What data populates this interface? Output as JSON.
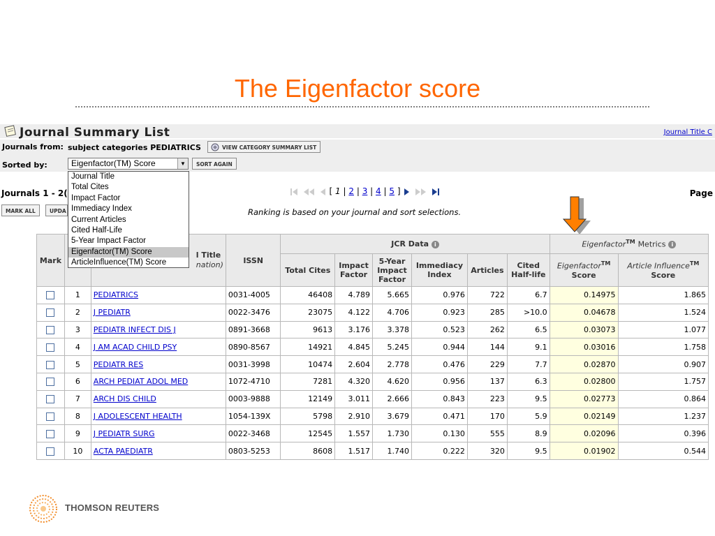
{
  "slide": {
    "title": "The Eigenfactor score"
  },
  "jcr": {
    "header_title": "Journal Summary List",
    "header_link": "Journal Title C",
    "journals_from_label": "Journals from:",
    "journals_from_value": "subject categories PEDIATRICS",
    "view_category_btn": "VIEW CATEGORY SUMMARY LIST",
    "sorted_by_label": "Sorted by:",
    "sort_selected": "Eigenfactor(TM) Score",
    "sort_again_btn": "SORT AGAIN",
    "sort_options": [
      "Journal Title",
      "Total Cites",
      "Impact Factor",
      "Immediacy Index",
      "Current Articles",
      "Cited Half-Life",
      "5-Year Impact Factor",
      "Eigenfactor(TM) Score",
      "ArticleInfluence(TM) Score"
    ],
    "range_text": "Journals 1 - 2(",
    "mark_all_btn": "MARK ALL",
    "update_btn": "UPDA",
    "pager": {
      "open": "[",
      "current": "1",
      "pages": [
        "2",
        "3",
        "4",
        "5"
      ],
      "sep": "|",
      "close": "]"
    },
    "page_label": "Page",
    "ranking_note": "Ranking is based on your journal and sort selections."
  },
  "table": {
    "headers": {
      "mark": "Mark",
      "title_partial": "l Title",
      "title_sub_partial": "nation)",
      "issn": "ISSN",
      "jcr_group": "JCR Data",
      "total_cites": "Total Cites",
      "impact_factor_1": "Impact",
      "impact_factor_2": "Factor",
      "five_year_1": "5-Year",
      "five_year_2": "Impact",
      "five_year_3": "Factor",
      "immediacy_1": "Immediacy",
      "immediacy_2": "Index",
      "articles": "Articles",
      "cited_hl_1": "Cited",
      "cited_hl_2": "Half-life",
      "eig_group": "Eigenfactor",
      "eig_group_tm": "TM",
      "eig_group_suffix": "Metrics",
      "eig_score_1": "Eigenfactor",
      "eig_score_tm": "TM",
      "eig_score_2": "Score",
      "ai_score_1": "Article Influence",
      "ai_score_tm": "TM",
      "ai_score_2": "Score"
    },
    "rows": [
      {
        "rank": "1",
        "title": "PEDIATRICS",
        "issn": "0031-4005",
        "total_cites": "46408",
        "impact_factor": "4.789",
        "five_year": "5.665",
        "immediacy": "0.976",
        "articles": "722",
        "cited_hl": "6.7",
        "eigenfactor": "0.14975",
        "ai": "1.865"
      },
      {
        "rank": "2",
        "title": "J PEDIATR",
        "issn": "0022-3476",
        "total_cites": "23075",
        "impact_factor": "4.122",
        "five_year": "4.706",
        "immediacy": "0.923",
        "articles": "285",
        "cited_hl": ">10.0",
        "eigenfactor": "0.04678",
        "ai": "1.524"
      },
      {
        "rank": "3",
        "title": "PEDIATR INFECT DIS J",
        "issn": "0891-3668",
        "total_cites": "9613",
        "impact_factor": "3.176",
        "five_year": "3.378",
        "immediacy": "0.523",
        "articles": "262",
        "cited_hl": "6.5",
        "eigenfactor": "0.03073",
        "ai": "1.077"
      },
      {
        "rank": "4",
        "title": "J AM ACAD CHILD PSY",
        "issn": "0890-8567",
        "total_cites": "14921",
        "impact_factor": "4.845",
        "five_year": "5.245",
        "immediacy": "0.944",
        "articles": "144",
        "cited_hl": "9.1",
        "eigenfactor": "0.03016",
        "ai": "1.758"
      },
      {
        "rank": "5",
        "title": "PEDIATR RES",
        "issn": "0031-3998",
        "total_cites": "10474",
        "impact_factor": "2.604",
        "five_year": "2.778",
        "immediacy": "0.476",
        "articles": "229",
        "cited_hl": "7.7",
        "eigenfactor": "0.02870",
        "ai": "0.907"
      },
      {
        "rank": "6",
        "title": "ARCH PEDIAT ADOL MED",
        "issn": "1072-4710",
        "total_cites": "7281",
        "impact_factor": "4.320",
        "five_year": "4.620",
        "immediacy": "0.956",
        "articles": "137",
        "cited_hl": "6.3",
        "eigenfactor": "0.02800",
        "ai": "1.757"
      },
      {
        "rank": "7",
        "title": "ARCH DIS CHILD",
        "issn": "0003-9888",
        "total_cites": "12149",
        "impact_factor": "3.011",
        "five_year": "2.666",
        "immediacy": "0.843",
        "articles": "223",
        "cited_hl": "9.5",
        "eigenfactor": "0.02773",
        "ai": "0.864"
      },
      {
        "rank": "8",
        "title": "J ADOLESCENT HEALTH",
        "issn": "1054-139X",
        "total_cites": "5798",
        "impact_factor": "2.910",
        "five_year": "3.679",
        "immediacy": "0.471",
        "articles": "170",
        "cited_hl": "5.9",
        "eigenfactor": "0.02149",
        "ai": "1.237"
      },
      {
        "rank": "9",
        "title": "J PEDIATR SURG",
        "issn": "0022-3468",
        "total_cites": "12545",
        "impact_factor": "1.557",
        "five_year": "1.730",
        "immediacy": "0.130",
        "articles": "555",
        "cited_hl": "8.9",
        "eigenfactor": "0.02096",
        "ai": "0.396"
      },
      {
        "rank": "10",
        "title": "ACTA PAEDIATR",
        "issn": "0803-5253",
        "total_cites": "8608",
        "impact_factor": "1.517",
        "five_year": "1.740",
        "immediacy": "0.222",
        "articles": "320",
        "cited_hl": "9.5",
        "eigenfactor": "0.01902",
        "ai": "0.544"
      }
    ]
  },
  "footer": {
    "logo_text": "THOMSON REUTERS"
  },
  "colors": {
    "title": "#ff6600",
    "arrow": "#ff7f00",
    "link": "#0000cc",
    "eig_highlight": "#ffffe0"
  },
  "icons": {
    "header": "notepad-icon",
    "view_btn": "category-icon",
    "arrow": "down-arrow-icon",
    "info": "info-icon",
    "logo": "thomson-reuters-logo"
  }
}
